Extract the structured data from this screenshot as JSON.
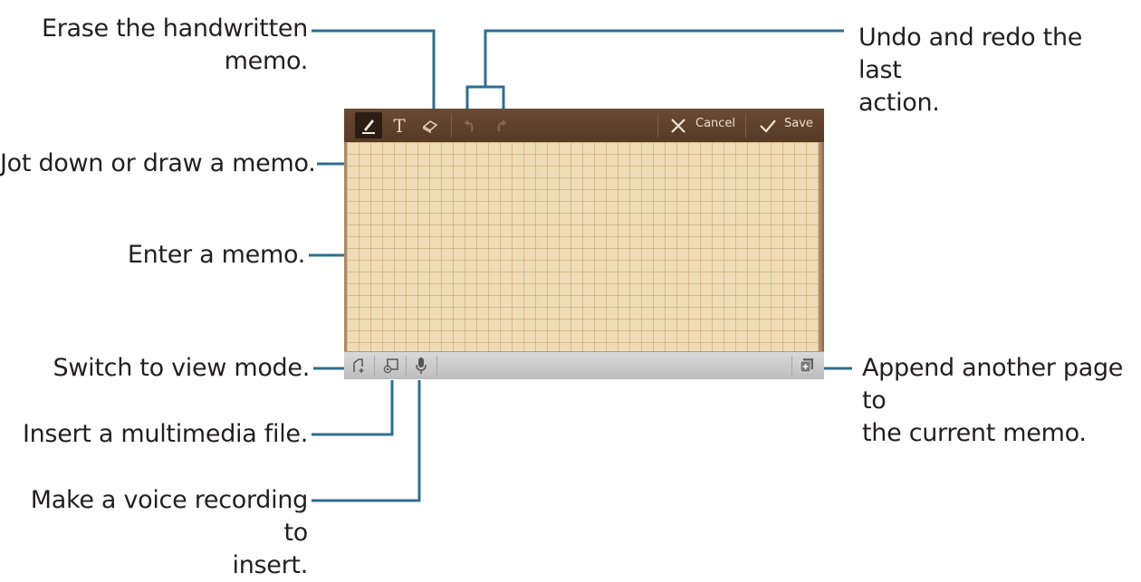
{
  "callouts": {
    "erase": "Erase the handwritten\nmemo.",
    "undo_redo": "Undo and redo the last\naction.",
    "jot": "Jot down or draw a memo.",
    "enter": "Enter a memo.",
    "view_mode": "Switch to view mode.",
    "multimedia": "Insert a multimedia file.",
    "voice": "Make a voice recording to\ninsert.",
    "append": "Append another page to\nthe current memo."
  },
  "toolbar": {
    "text_tool_glyph": "T",
    "cancel_label": "Cancel",
    "save_label": "Save"
  },
  "icons": {
    "pen": "pen-icon",
    "text": "text-tool-icon",
    "eraser": "eraser-icon",
    "undo": "undo-icon",
    "redo": "redo-icon",
    "cancel": "close-icon",
    "save": "checkmark-icon",
    "view_mode": "view-mode-icon",
    "multimedia": "insert-media-icon",
    "voice": "microphone-icon",
    "add_page": "add-page-icon"
  },
  "colors": {
    "toolbar": "#5e412c",
    "paper": "#efdcb7",
    "grid": "#c3a06e",
    "bottombar": "#cccccc",
    "leader": "#2f6e8e"
  }
}
